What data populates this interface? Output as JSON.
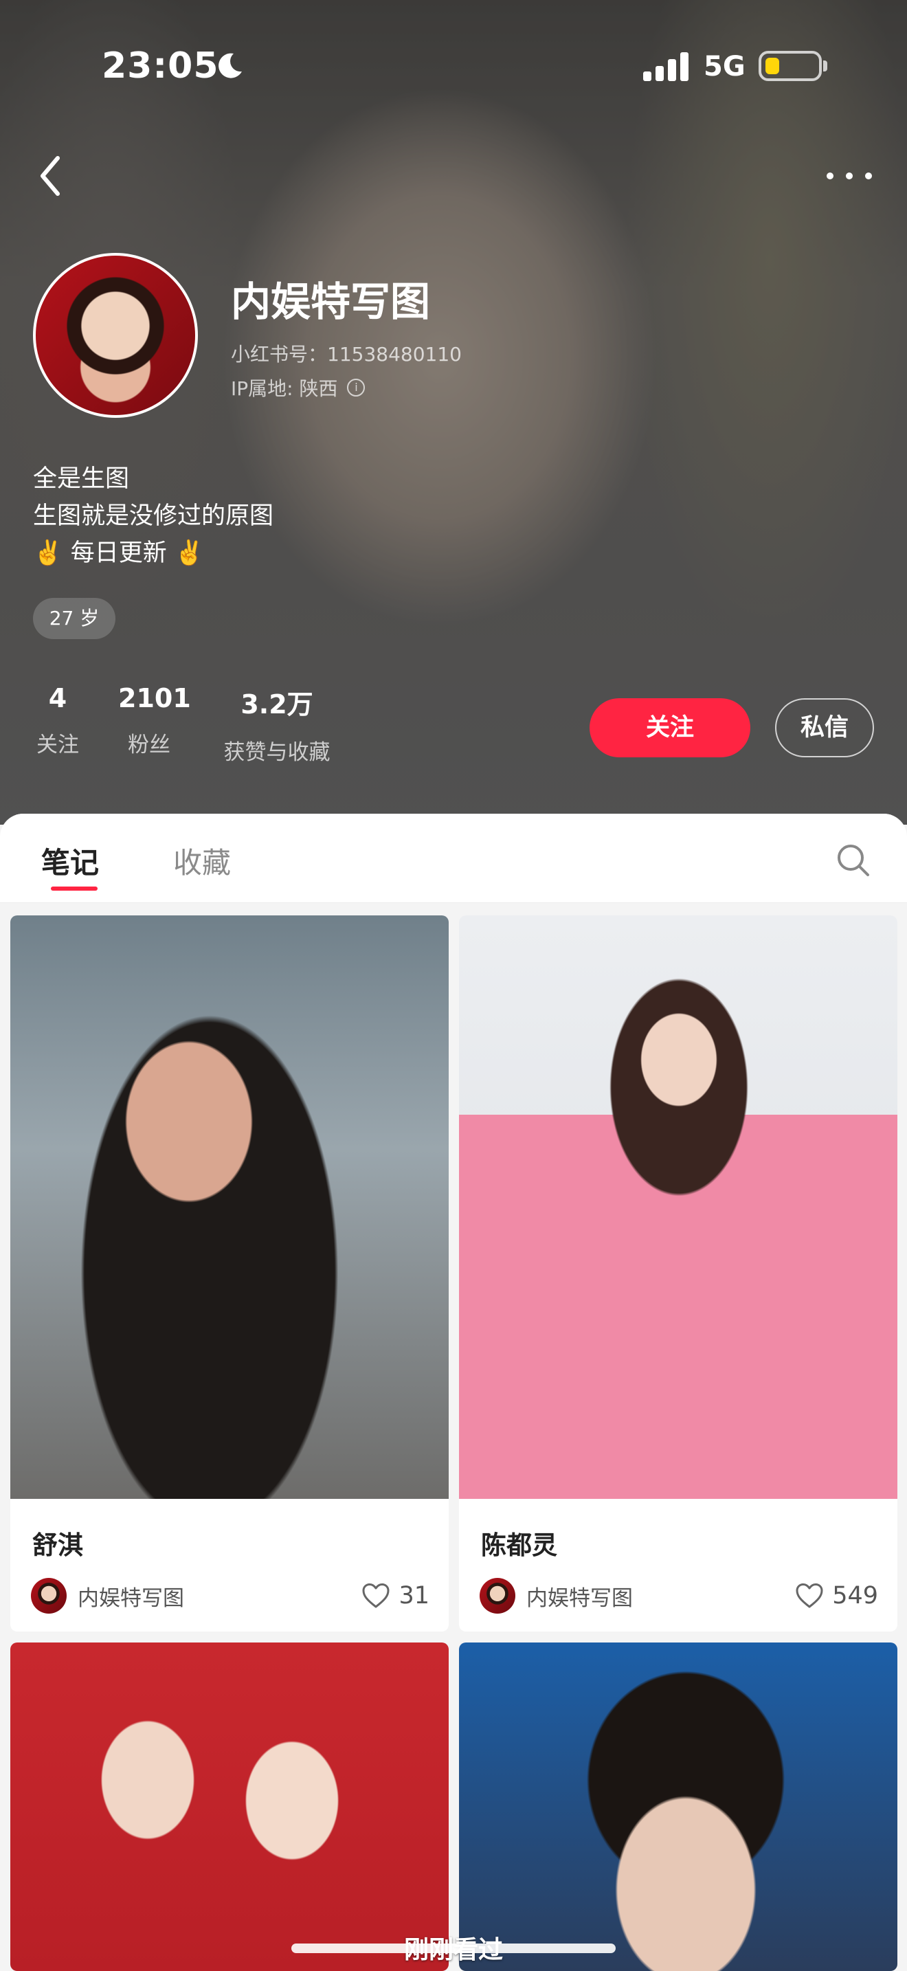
{
  "status_bar": {
    "time": "23:05",
    "network": "5G"
  },
  "profile": {
    "name": "内娱特写图",
    "id_line": "小红书号：11538480110",
    "ip_line": "IP属地: 陕西",
    "bio": [
      "全是生图",
      "生图就是没修过的原图",
      "✌️ 每日更新 ✌️"
    ],
    "age": "27 岁"
  },
  "stats": [
    {
      "value": "4",
      "label": "关注"
    },
    {
      "value": "2101",
      "label": "粉丝"
    },
    {
      "value": "3.2万",
      "label": "获赞与收藏"
    }
  ],
  "actions": {
    "follow": "关注",
    "message": "私信"
  },
  "tabs": {
    "notes": "笔记",
    "favorites": "收藏"
  },
  "notes": [
    {
      "title": "舒淇",
      "author": "内娱特写图",
      "likes": "31"
    },
    {
      "title": "陈都灵",
      "author": "内娱特写图",
      "likes": "549"
    },
    {
      "title": "",
      "author": "",
      "likes": ""
    },
    {
      "title": "",
      "author": "",
      "likes": ""
    }
  ],
  "recent_toast": "刚刚看过"
}
